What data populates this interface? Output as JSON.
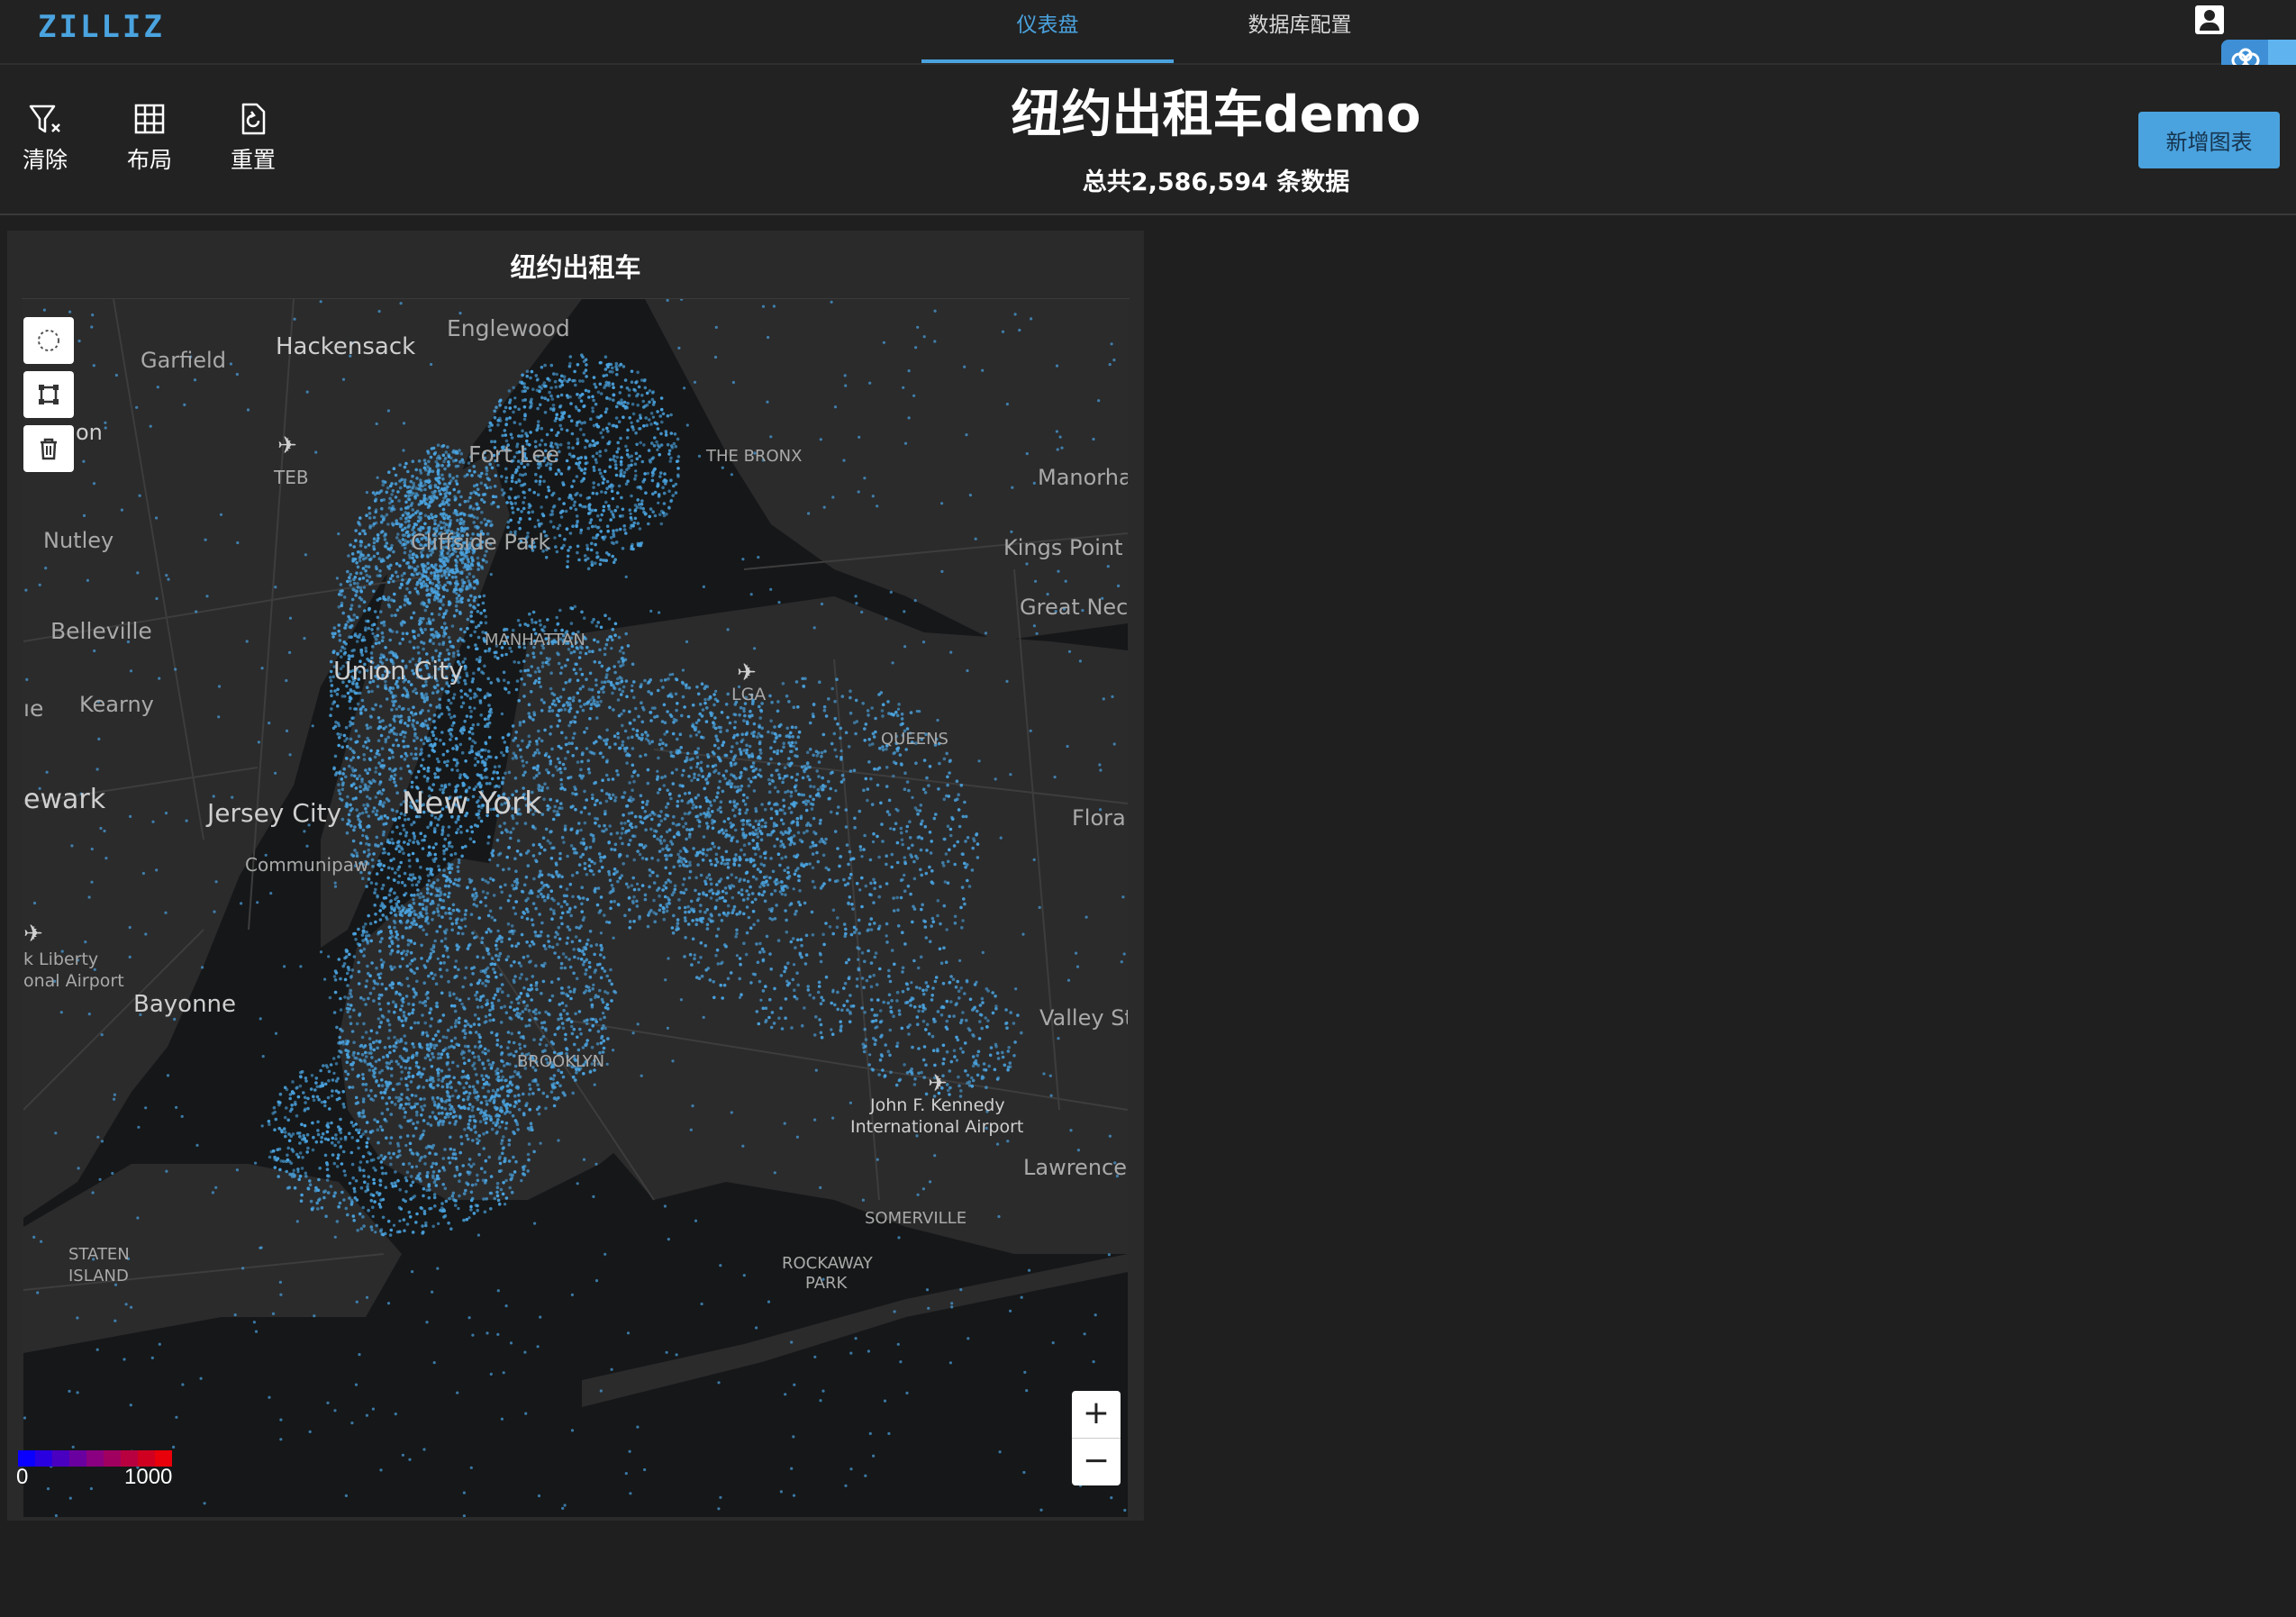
{
  "app": {
    "logo": "ZILLIZ"
  },
  "nav": {
    "tabs": [
      {
        "label": "仪表盘",
        "active": true
      },
      {
        "label": "数据库配置",
        "active": false
      }
    ]
  },
  "toolbar": {
    "clear": "清除",
    "layout": "布局",
    "reset": "重置"
  },
  "header": {
    "title": "纽约出租车demo",
    "subtitle": "总共2,586,594 条数据",
    "add_chart": "新增图表"
  },
  "chart": {
    "title": "纽约出租车",
    "accent": "#4aa3df",
    "map_labels": {
      "garfield": "Garfield",
      "hackensack": "Hackensack",
      "englewood": "Englewood",
      "clifton": "on",
      "teb": "TEB",
      "fort_lee": "Fort Lee",
      "bronx": "THE BRONX",
      "manorhaven": "Manorhav",
      "nutley": "Nutley",
      "cliffside": "Cliffside Park",
      "kings_point": "Kings Point",
      "great_neck": "Great Neck",
      "belleville": "Belleville",
      "manhattan": "MANHATTAN",
      "union_city": "Union City",
      "lga": "LGA",
      "kearny": "Kearny",
      "kearny_prefix": "ıe",
      "queens": "QUEENS",
      "newark": "ewark",
      "jersey_city": "Jersey City",
      "new_york": "New York",
      "floral": "Floral",
      "communipaw": "Communipaw",
      "liberty1": "k Liberty",
      "liberty2": "onal Airport",
      "bayonne": "Bayonne",
      "valley": "Valley St",
      "brooklyn": "BROOKLYN",
      "jfk1": "John F. Kennedy",
      "jfk2": "International Airport",
      "lawrence": "Lawrence",
      "somerville": "SOMERVILLE",
      "rockaway1": "ROCKAWAY",
      "rockaway2": "PARK",
      "staten1": "STATEN",
      "staten2": "ISLAND"
    },
    "legend": {
      "min": "0",
      "max": "1000",
      "colors": [
        "#0a00ff",
        "#2a00e0",
        "#4a00c0",
        "#6a00a0",
        "#8a0080",
        "#a00060",
        "#b80040",
        "#d00020",
        "#e8000a"
      ]
    },
    "zoom_in": "+",
    "zoom_out": "−"
  }
}
